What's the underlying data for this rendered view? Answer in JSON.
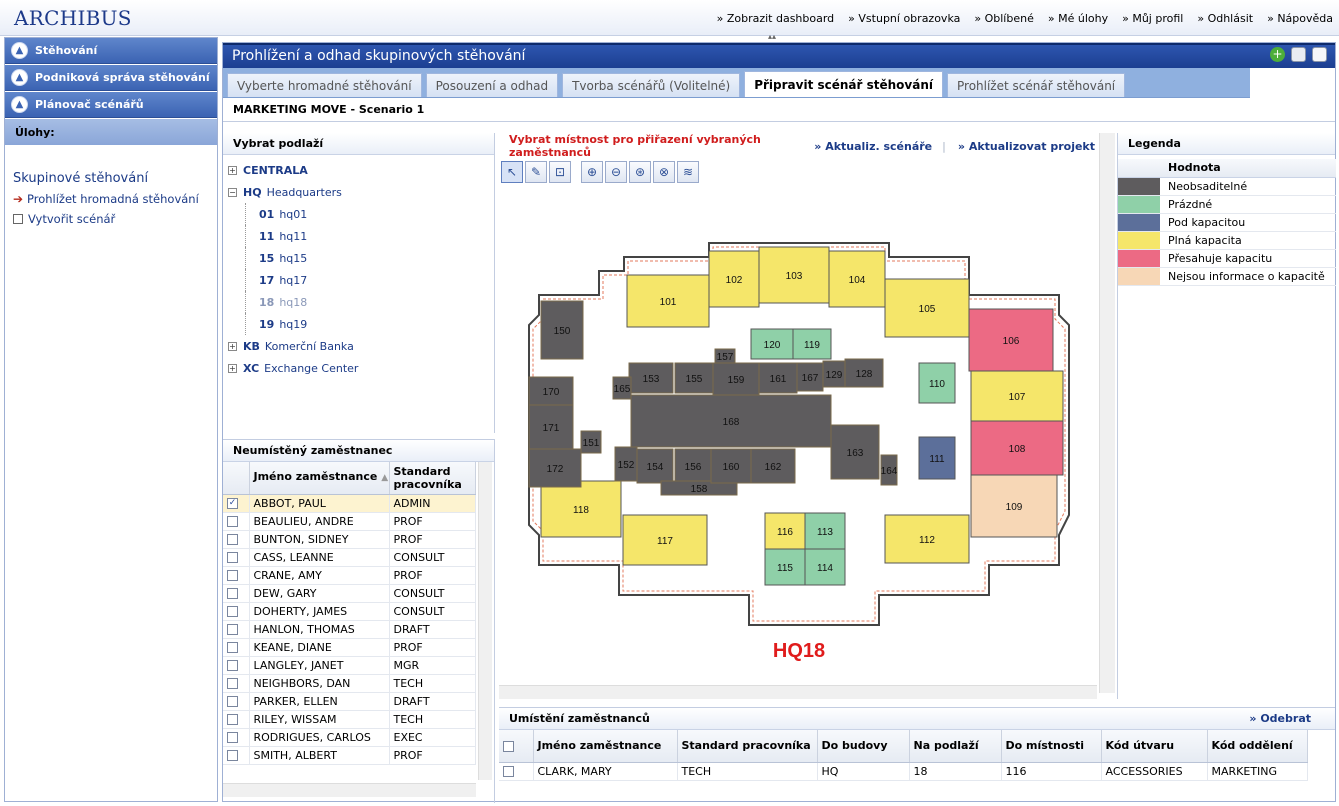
{
  "app": {
    "logo": "ARCHIBUS"
  },
  "topnav": [
    "Zobrazit dashboard",
    "Vstupní obrazovka",
    "Oblíbené",
    "Mé úlohy",
    "Můj profil",
    "Odhlásit",
    "Nápověda"
  ],
  "sidebar": {
    "nav": [
      "Stěhování",
      "Podniková správa stěhování",
      "Plánovač scénářů"
    ],
    "tasks_label": "Úlohy:",
    "tasks_title": "Skupinové stěhování",
    "tasks": [
      {
        "label": "Prohlížet hromadná stěhování",
        "current": true
      },
      {
        "label": "Vytvořit scénář",
        "current": false
      }
    ]
  },
  "main": {
    "title": "Prohlížení a odhad skupinových stěhování",
    "tabs": [
      "Vyberte hromadné stěhování",
      "Posouzení a odhad",
      "Tvorba scénářů (Volitelné)",
      "Připravit scénář stěhování",
      "Prohlížet scénář stěhování"
    ],
    "active_tab": 3,
    "scenario": "MARKETING MOVE - Scenario 1"
  },
  "floors": {
    "title": "Vybrat podlaží",
    "buildings": [
      {
        "code": "CENTRALA",
        "name": "",
        "expanded": false
      },
      {
        "code": "HQ",
        "name": "Headquarters",
        "expanded": true
      },
      {
        "code": "KB",
        "name": "Komerční Banka",
        "expanded": false
      },
      {
        "code": "XC",
        "name": "Exchange Center",
        "expanded": false
      }
    ],
    "hq_floors": [
      {
        "code": "01",
        "name": "hq01",
        "dim": false
      },
      {
        "code": "11",
        "name": "hq11",
        "dim": false
      },
      {
        "code": "15",
        "name": "hq15",
        "dim": false
      },
      {
        "code": "17",
        "name": "hq17",
        "dim": false
      },
      {
        "code": "18",
        "name": "hq18",
        "dim": true
      },
      {
        "code": "19",
        "name": "hq19",
        "dim": false
      }
    ]
  },
  "employees": {
    "title": "Neumístěný zaměstnanec",
    "col_name": "Jméno zaměstnance",
    "col_std": "Standard pracovníka",
    "rows": [
      {
        "name": "ABBOT, PAUL",
        "std": "ADMIN",
        "checked": true
      },
      {
        "name": "BEAULIEU, ANDRE",
        "std": "PROF",
        "checked": false
      },
      {
        "name": "BUNTON, SIDNEY",
        "std": "PROF",
        "checked": false
      },
      {
        "name": "CASS, LEANNE",
        "std": "CONSULT",
        "checked": false
      },
      {
        "name": "CRANE, AMY",
        "std": "PROF",
        "checked": false
      },
      {
        "name": "DEW, GARY",
        "std": "CONSULT",
        "checked": false
      },
      {
        "name": "DOHERTY, JAMES",
        "std": "CONSULT",
        "checked": false
      },
      {
        "name": "HANLON, THOMAS",
        "std": "DRAFT",
        "checked": false
      },
      {
        "name": "KEANE, DIANE",
        "std": "PROF",
        "checked": false
      },
      {
        "name": "LANGLEY, JANET",
        "std": "MGR",
        "checked": false
      },
      {
        "name": "NEIGHBORS, DAN",
        "std": "TECH",
        "checked": false
      },
      {
        "name": "PARKER, ELLEN",
        "std": "DRAFT",
        "checked": false
      },
      {
        "name": "RILEY, WISSAM",
        "std": "TECH",
        "checked": false
      },
      {
        "name": "RODRIGUES, CARLOS",
        "std": "EXEC",
        "checked": false
      },
      {
        "name": "SMITH, ALBERT",
        "std": "PROF",
        "checked": false
      }
    ]
  },
  "drawing": {
    "message": "Vybrat místnost pro přiřazení vybraných zaměstnanců",
    "links": [
      "Aktualiz. scénáře",
      "Aktualizovat projekt stě"
    ],
    "floor_label": "HQ18",
    "tools": [
      "select-icon",
      "assign-icon",
      "zoom-window-icon",
      "zoom-in-icon",
      "zoom-out-icon",
      "zoom-extents-icon",
      "zoom-selected-icon",
      "layers-icon"
    ]
  },
  "legend": {
    "title": "Legenda",
    "col": "Hodnota",
    "items": [
      {
        "label": "Neobsaditelné",
        "color": "#5e5c5e"
      },
      {
        "label": "Prázdné",
        "color": "#8fd0a8"
      },
      {
        "label": "Pod kapacitou",
        "color": "#5c6f9a"
      },
      {
        "label": "Plná kapacita",
        "color": "#f5e66a"
      },
      {
        "label": "Přesahuje kapacitu",
        "color": "#ec6a84"
      },
      {
        "label": "Nejsou informace o kapacitě",
        "color": "#f7d7b6"
      }
    ]
  },
  "assignments": {
    "title": "Umístění zaměstnanců",
    "remove": "Odebrat",
    "cols": [
      "Jméno zaměstnance",
      "Standard pracovníka",
      "Do budovy",
      "Na podlaží",
      "Do místnosti",
      "Kód útvaru",
      "Kód oddělení"
    ],
    "rows": [
      [
        "CLARK, MARY",
        "TECH",
        "HQ",
        "18",
        "116",
        "ACCESSORIES",
        "MARKETING"
      ]
    ]
  },
  "rooms": [
    {
      "id": "101",
      "status": "full"
    },
    {
      "id": "102",
      "status": "full"
    },
    {
      "id": "103",
      "status": "full"
    },
    {
      "id": "104",
      "status": "full"
    },
    {
      "id": "105",
      "status": "full"
    },
    {
      "id": "106",
      "status": "over"
    },
    {
      "id": "107",
      "status": "full"
    },
    {
      "id": "108",
      "status": "over"
    },
    {
      "id": "109",
      "status": "noinfo"
    },
    {
      "id": "110",
      "status": "empty"
    },
    {
      "id": "111",
      "status": "under"
    },
    {
      "id": "112",
      "status": "full"
    },
    {
      "id": "113",
      "status": "empty"
    },
    {
      "id": "114",
      "status": "empty"
    },
    {
      "id": "115",
      "status": "empty"
    },
    {
      "id": "116",
      "status": "full"
    },
    {
      "id": "117",
      "status": "full"
    },
    {
      "id": "118",
      "status": "full"
    },
    {
      "id": "119",
      "status": "empty"
    },
    {
      "id": "120",
      "status": "empty"
    },
    {
      "id": "128",
      "status": "vacant"
    },
    {
      "id": "129",
      "status": "vacant"
    },
    {
      "id": "150",
      "status": "vacant"
    },
    {
      "id": "151",
      "status": "vacant"
    },
    {
      "id": "152",
      "status": "vacant"
    },
    {
      "id": "153",
      "status": "vacant"
    },
    {
      "id": "154",
      "status": "vacant"
    },
    {
      "id": "155",
      "status": "vacant"
    },
    {
      "id": "156",
      "status": "vacant"
    },
    {
      "id": "157",
      "status": "vacant"
    },
    {
      "id": "158",
      "status": "vacant"
    },
    {
      "id": "159",
      "status": "vacant"
    },
    {
      "id": "160",
      "status": "vacant"
    },
    {
      "id": "161",
      "status": "vacant"
    },
    {
      "id": "162",
      "status": "vacant"
    },
    {
      "id": "163",
      "status": "vacant"
    },
    {
      "id": "164",
      "status": "vacant"
    },
    {
      "id": "165",
      "status": "vacant"
    },
    {
      "id": "167",
      "status": "vacant"
    },
    {
      "id": "168",
      "status": "vacant"
    },
    {
      "id": "170",
      "status": "vacant"
    },
    {
      "id": "171",
      "status": "vacant"
    },
    {
      "id": "172",
      "status": "vacant"
    }
  ]
}
